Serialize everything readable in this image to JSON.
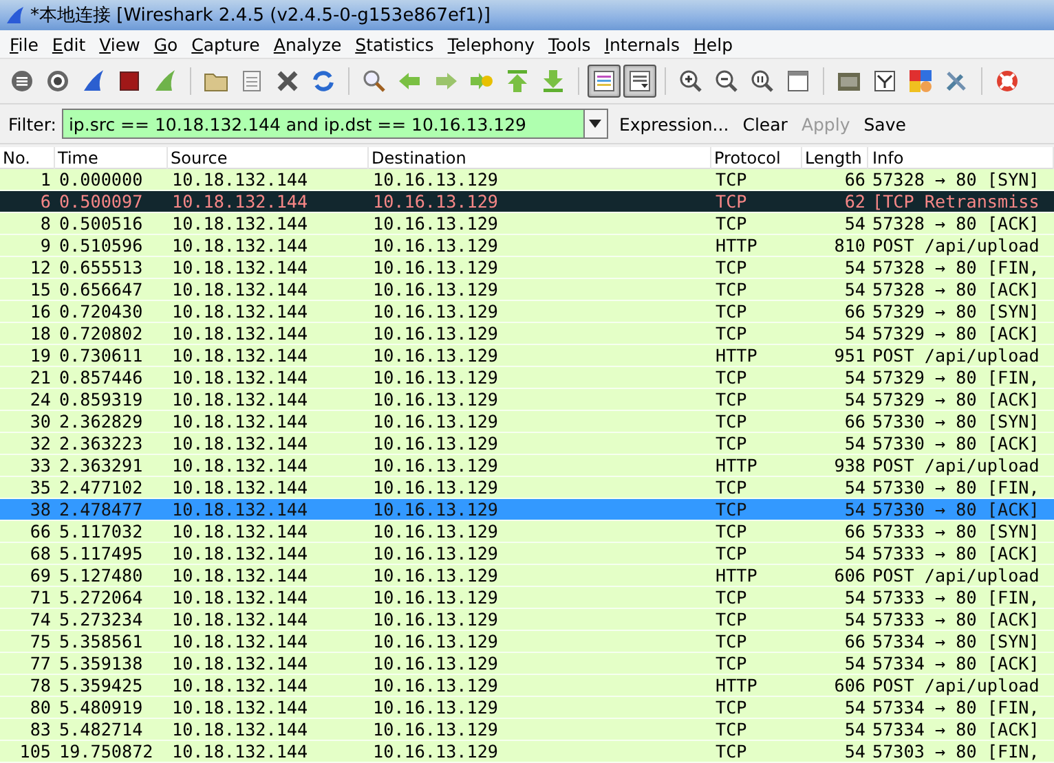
{
  "window": {
    "title": "*本地连接 [Wireshark 2.4.5 (v2.4.5-0-g153e867ef1)]"
  },
  "menu": [
    "File",
    "Edit",
    "View",
    "Go",
    "Capture",
    "Analyze",
    "Statistics",
    "Telephony",
    "Tools",
    "Internals",
    "Help"
  ],
  "toolbar": [
    {
      "kind": "interfaces",
      "pressed": false
    },
    {
      "kind": "options",
      "pressed": false
    },
    {
      "kind": "start",
      "pressed": false
    },
    {
      "kind": "stop",
      "pressed": false
    },
    {
      "kind": "restart",
      "pressed": false
    },
    {
      "kind": "separator"
    },
    {
      "kind": "open",
      "pressed": false
    },
    {
      "kind": "save",
      "pressed": false
    },
    {
      "kind": "close",
      "pressed": false
    },
    {
      "kind": "reload",
      "pressed": false
    },
    {
      "kind": "separator"
    },
    {
      "kind": "find",
      "pressed": false
    },
    {
      "kind": "back",
      "pressed": false
    },
    {
      "kind": "forward",
      "pressed": false
    },
    {
      "kind": "goto",
      "pressed": false
    },
    {
      "kind": "first",
      "pressed": false
    },
    {
      "kind": "last",
      "pressed": false
    },
    {
      "kind": "separator"
    },
    {
      "kind": "colorize",
      "pressed": true
    },
    {
      "kind": "autoscroll",
      "pressed": true
    },
    {
      "kind": "separator"
    },
    {
      "kind": "zoom_in",
      "pressed": false
    },
    {
      "kind": "zoom_out",
      "pressed": false
    },
    {
      "kind": "zoom_reset",
      "pressed": false
    },
    {
      "kind": "resize",
      "pressed": false
    },
    {
      "kind": "separator"
    },
    {
      "kind": "capture_filters",
      "pressed": false
    },
    {
      "kind": "display_filters",
      "pressed": false
    },
    {
      "kind": "coloring",
      "pressed": false
    },
    {
      "kind": "preferences",
      "pressed": false
    },
    {
      "kind": "separator"
    },
    {
      "kind": "help",
      "pressed": false
    }
  ],
  "filter": {
    "label": "Filter:",
    "value": "ip.src == 10.18.132.144 and ip.dst == 10.16.13.129",
    "buttons": [
      {
        "label": "Expression...",
        "disabled": false
      },
      {
        "label": "Clear",
        "disabled": false
      },
      {
        "label": "Apply",
        "disabled": true
      },
      {
        "label": "Save",
        "disabled": false
      }
    ]
  },
  "table": {
    "columns": [
      "No.",
      "Time",
      "Source",
      "Destination",
      "Protocol",
      "Length",
      "Info"
    ],
    "rows": [
      {
        "cells": [
          "1",
          "0.000000",
          "10.18.132.144",
          "10.16.13.129",
          "TCP",
          "66",
          "57328 → 80 [SYN]"
        ],
        "kind": "normal",
        "selected": false
      },
      {
        "cells": [
          "6",
          "0.500097",
          "10.18.132.144",
          "10.16.13.129",
          "TCP",
          "62",
          "[TCP Retransmiss"
        ],
        "kind": "bad",
        "selected": false
      },
      {
        "cells": [
          "8",
          "0.500516",
          "10.18.132.144",
          "10.16.13.129",
          "TCP",
          "54",
          "57328 → 80 [ACK]"
        ],
        "kind": "normal",
        "selected": false
      },
      {
        "cells": [
          "9",
          "0.510596",
          "10.18.132.144",
          "10.16.13.129",
          "HTTP",
          "810",
          "POST /api/upload"
        ],
        "kind": "normal",
        "selected": false
      },
      {
        "cells": [
          "12",
          "0.655513",
          "10.18.132.144",
          "10.16.13.129",
          "TCP",
          "54",
          "57328 → 80 [FIN,"
        ],
        "kind": "normal",
        "selected": false
      },
      {
        "cells": [
          "15",
          "0.656647",
          "10.18.132.144",
          "10.16.13.129",
          "TCP",
          "54",
          "57328 → 80 [ACK]"
        ],
        "kind": "normal",
        "selected": false
      },
      {
        "cells": [
          "16",
          "0.720430",
          "10.18.132.144",
          "10.16.13.129",
          "TCP",
          "66",
          "57329 → 80 [SYN]"
        ],
        "kind": "normal",
        "selected": false
      },
      {
        "cells": [
          "18",
          "0.720802",
          "10.18.132.144",
          "10.16.13.129",
          "TCP",
          "54",
          "57329 → 80 [ACK]"
        ],
        "kind": "normal",
        "selected": false
      },
      {
        "cells": [
          "19",
          "0.730611",
          "10.18.132.144",
          "10.16.13.129",
          "HTTP",
          "951",
          "POST /api/upload"
        ],
        "kind": "normal",
        "selected": false
      },
      {
        "cells": [
          "21",
          "0.857446",
          "10.18.132.144",
          "10.16.13.129",
          "TCP",
          "54",
          "57329 → 80 [FIN,"
        ],
        "kind": "normal",
        "selected": false
      },
      {
        "cells": [
          "24",
          "0.859319",
          "10.18.132.144",
          "10.16.13.129",
          "TCP",
          "54",
          "57329 → 80 [ACK]"
        ],
        "kind": "normal",
        "selected": false
      },
      {
        "cells": [
          "30",
          "2.362829",
          "10.18.132.144",
          "10.16.13.129",
          "TCP",
          "66",
          "57330 → 80 [SYN]"
        ],
        "kind": "normal",
        "selected": false
      },
      {
        "cells": [
          "32",
          "2.363223",
          "10.18.132.144",
          "10.16.13.129",
          "TCP",
          "54",
          "57330 → 80 [ACK]"
        ],
        "kind": "normal",
        "selected": false
      },
      {
        "cells": [
          "33",
          "2.363291",
          "10.18.132.144",
          "10.16.13.129",
          "HTTP",
          "938",
          "POST /api/upload"
        ],
        "kind": "normal",
        "selected": false
      },
      {
        "cells": [
          "35",
          "2.477102",
          "10.18.132.144",
          "10.16.13.129",
          "TCP",
          "54",
          "57330 → 80 [FIN,"
        ],
        "kind": "normal",
        "selected": false
      },
      {
        "cells": [
          "38",
          "2.478477",
          "10.18.132.144",
          "10.16.13.129",
          "TCP",
          "54",
          "57330 → 80 [ACK]"
        ],
        "kind": "normal",
        "selected": true
      },
      {
        "cells": [
          "66",
          "5.117032",
          "10.18.132.144",
          "10.16.13.129",
          "TCP",
          "66",
          "57333 → 80 [SYN]"
        ],
        "kind": "normal",
        "selected": false
      },
      {
        "cells": [
          "68",
          "5.117495",
          "10.18.132.144",
          "10.16.13.129",
          "TCP",
          "54",
          "57333 → 80 [ACK]"
        ],
        "kind": "normal",
        "selected": false
      },
      {
        "cells": [
          "69",
          "5.127480",
          "10.18.132.144",
          "10.16.13.129",
          "HTTP",
          "606",
          "POST /api/upload"
        ],
        "kind": "normal",
        "selected": false
      },
      {
        "cells": [
          "71",
          "5.272064",
          "10.18.132.144",
          "10.16.13.129",
          "TCP",
          "54",
          "57333 → 80 [FIN,"
        ],
        "kind": "normal",
        "selected": false
      },
      {
        "cells": [
          "74",
          "5.273234",
          "10.18.132.144",
          "10.16.13.129",
          "TCP",
          "54",
          "57333 → 80 [ACK]"
        ],
        "kind": "normal",
        "selected": false
      },
      {
        "cells": [
          "75",
          "5.358561",
          "10.18.132.144",
          "10.16.13.129",
          "TCP",
          "66",
          "57334 → 80 [SYN]"
        ],
        "kind": "normal",
        "selected": false
      },
      {
        "cells": [
          "77",
          "5.359138",
          "10.18.132.144",
          "10.16.13.129",
          "TCP",
          "54",
          "57334 → 80 [ACK]"
        ],
        "kind": "normal",
        "selected": false
      },
      {
        "cells": [
          "78",
          "5.359425",
          "10.18.132.144",
          "10.16.13.129",
          "HTTP",
          "606",
          "POST /api/upload"
        ],
        "kind": "normal",
        "selected": false
      },
      {
        "cells": [
          "80",
          "5.480919",
          "10.18.132.144",
          "10.16.13.129",
          "TCP",
          "54",
          "57334 → 80 [FIN,"
        ],
        "kind": "normal",
        "selected": false
      },
      {
        "cells": [
          "83",
          "5.482714",
          "10.18.132.144",
          "10.16.13.129",
          "TCP",
          "54",
          "57334 → 80 [ACK]"
        ],
        "kind": "normal",
        "selected": false
      },
      {
        "cells": [
          "105",
          "19.750872",
          "10.18.132.144",
          "10.16.13.129",
          "TCP",
          "54",
          "57303 → 80 [FIN,"
        ],
        "kind": "normal",
        "selected": false
      }
    ]
  }
}
